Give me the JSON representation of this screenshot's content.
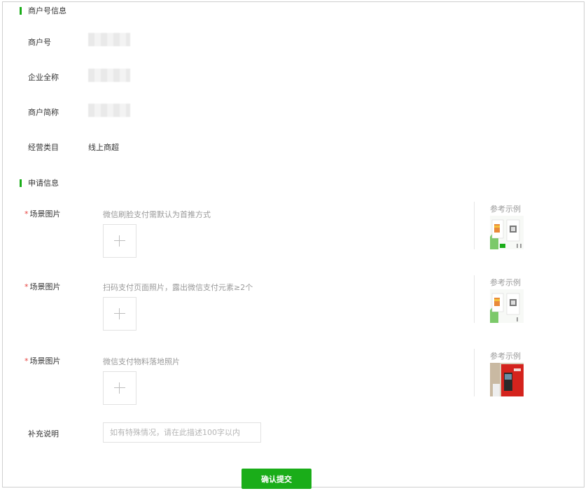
{
  "merchant_section": {
    "title": "商户号信息",
    "fields": [
      {
        "label": "商户号",
        "value": ""
      },
      {
        "label": "企业全称",
        "value": ""
      },
      {
        "label": "商户简称",
        "value": ""
      },
      {
        "label": "经营类目",
        "value": "线上商超"
      }
    ]
  },
  "apply_section": {
    "title": "申请信息",
    "required_mark": "*",
    "scene_items": [
      {
        "label": "场景图片",
        "hint": "微信刷脸支付需默认为首推方式",
        "ref_label": "参考示例",
        "upload_icon": "plus-icon"
      },
      {
        "label": "场景图片",
        "hint": "扫码支付页面照片，露出微信支付元素≥2个",
        "ref_label": "参考示例",
        "upload_icon": "plus-icon"
      },
      {
        "label": "场景图片",
        "hint": "微信支付物料落地照片",
        "ref_label": "参考示例",
        "upload_icon": "plus-icon"
      }
    ],
    "supplement": {
      "label": "补充说明",
      "placeholder": "如有特殊情况，请在此描述100字以内"
    }
  },
  "submit_label": "确认提交",
  "colors": {
    "accent": "#1aad19",
    "required": "#e64340",
    "hint": "#9a9a9a"
  }
}
